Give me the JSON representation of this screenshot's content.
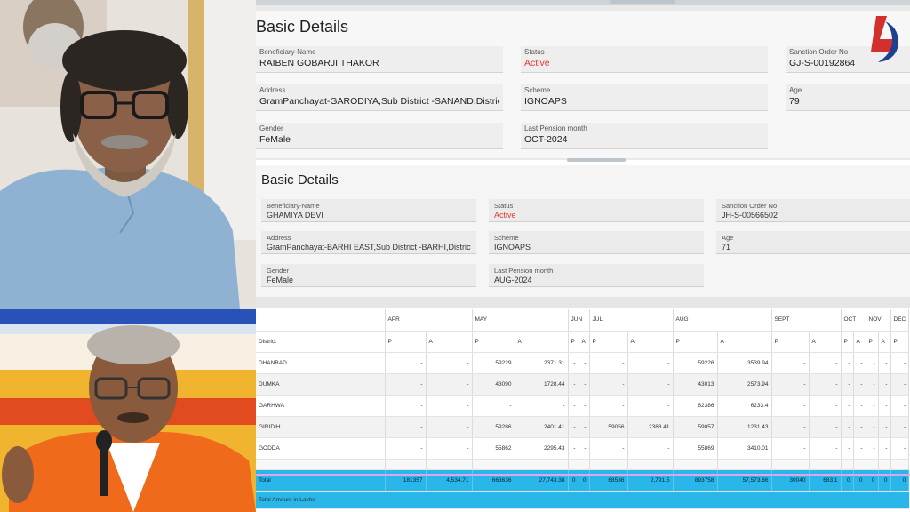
{
  "panel1": {
    "title": "Basic Details",
    "fields": [
      {
        "label": "Beneficiary-Name",
        "value": "RAIBEN GOBARJI THAKOR"
      },
      {
        "label": "Status",
        "value": "Active"
      },
      {
        "label": "Sanction Order No",
        "value": "GJ-S-00192864"
      },
      {
        "label": "Address",
        "value": "GramPanchayat-GARODIYA,Sub District -SANAND,District"
      },
      {
        "label": "Scheme",
        "value": "IGNOAPS"
      },
      {
        "label": "Age",
        "value": "79"
      },
      {
        "label": "Gender",
        "value": "FeMale"
      },
      {
        "label": "Last Pension month",
        "value": "OCT-2024"
      }
    ]
  },
  "panel2": {
    "title": "Basic Details",
    "fields": [
      {
        "label": "Beneficiary-Name",
        "value": "GHAMIYA DEVI"
      },
      {
        "label": "Status",
        "value": "Active"
      },
      {
        "label": "Sanction Order No",
        "value": "JH-S-00566502"
      },
      {
        "label": "Address",
        "value": "GramPanchayat-BARHI EAST,Sub District -BARHI,District -"
      },
      {
        "label": "Scheme",
        "value": "IGNOAPS"
      },
      {
        "label": "Age",
        "value": "71"
      },
      {
        "label": "Gender",
        "value": "FeMale"
      },
      {
        "label": "Last Pension month",
        "value": "AUG-2024"
      }
    ]
  },
  "colors": {
    "status_active": "#e53935",
    "total_row": "#29b6e8",
    "logo_red": "#d32f2f",
    "logo_blue": "#1f3f8f"
  },
  "table": {
    "district_header": "District",
    "months": [
      "APR",
      "MAY",
      "JUN",
      "JUL",
      "AUG",
      "SEPT",
      "OCT",
      "NOV",
      "DEC"
    ],
    "subheaders": [
      "P",
      "A",
      "P",
      "A",
      "P",
      "A",
      "P",
      "A",
      "P",
      "A",
      "P",
      "A",
      "P",
      "A",
      "P",
      "A",
      "P"
    ],
    "rows": [
      {
        "district": "DHANBAD",
        "cells": [
          "-",
          "-",
          "59229",
          "2371.31",
          "-",
          "-",
          "-",
          "-",
          "59226",
          "3539.94",
          "-",
          "-",
          "-",
          "-",
          "-",
          "-",
          "-"
        ]
      },
      {
        "district": "DUMKA",
        "cells": [
          "-",
          "-",
          "43090",
          "1728.44",
          "-",
          "-",
          "-",
          "-",
          "43013",
          "2573.94",
          "-",
          "-",
          "-",
          "-",
          "-",
          "-",
          "-"
        ]
      },
      {
        "district": "GARHWA",
        "cells": [
          "-",
          "-",
          "-",
          "-",
          "-",
          "-",
          "-",
          "-",
          "62386",
          "6233.4",
          "-",
          "-",
          "-",
          "-",
          "-",
          "-",
          "-"
        ]
      },
      {
        "district": "GIRIDIH",
        "cells": [
          "-",
          "-",
          "59286",
          "2401.41",
          "-",
          "-",
          "59056",
          "2388.41",
          "59057",
          "1231.43",
          "-",
          "-",
          "-",
          "-",
          "-",
          "-",
          "-"
        ]
      },
      {
        "district": "GODDA",
        "cells": [
          "-",
          "-",
          "55862",
          "2295.43",
          "-",
          "-",
          "-",
          "-",
          "55869",
          "3410.01",
          "-",
          "-",
          "-",
          "-",
          "-",
          "-",
          "-"
        ]
      }
    ],
    "total": {
      "label": "Total",
      "cells": [
        "181357",
        "4,534.71",
        "663636",
        "27,743.38",
        "0",
        "0",
        "68536",
        "2,791.5",
        "893758",
        "57,573.86",
        "30040",
        "683.1",
        "0",
        "0",
        "0",
        "0",
        "0"
      ]
    },
    "amount_label": "Total Amount in Lakhs"
  }
}
